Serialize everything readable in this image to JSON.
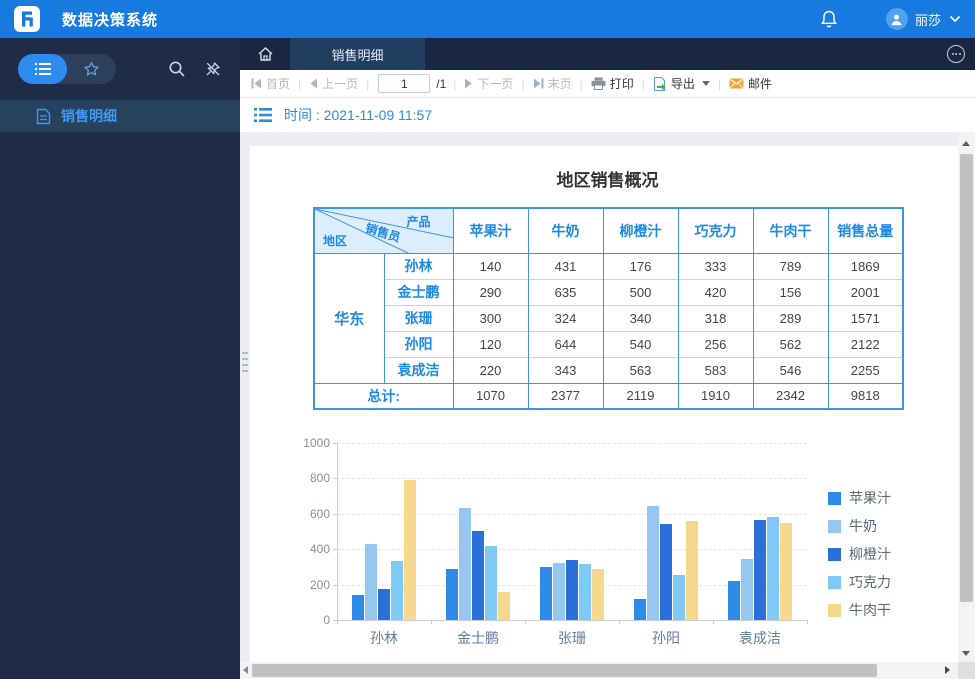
{
  "app": {
    "title": "数据决策系统",
    "user": "丽莎"
  },
  "sidebar": {
    "menu_item": "销售明细"
  },
  "tabs": {
    "active": "销售明细"
  },
  "toolbar": {
    "first": "首页",
    "prev": "上一页",
    "page_value": "1",
    "page_total": "/1",
    "next": "下一页",
    "last": "末页",
    "print": "打印",
    "export": "导出",
    "mail": "邮件"
  },
  "param_bar": {
    "time_label": "时间 : 2021-11-09 11:57"
  },
  "report": {
    "title": "地区销售概况",
    "table": {
      "corner": {
        "top": "产品",
        "middle": "销售员",
        "bottom": "地区"
      },
      "columns": [
        "苹果汁",
        "牛奶",
        "柳橙汁",
        "巧克力",
        "牛肉干",
        "销售总量"
      ],
      "region": "华东",
      "rows": [
        {
          "name": "孙林",
          "values": [
            140,
            431,
            176,
            333,
            789,
            1869
          ]
        },
        {
          "name": "金士鹏",
          "values": [
            290,
            635,
            500,
            420,
            156,
            2001
          ]
        },
        {
          "name": "张珊",
          "values": [
            300,
            324,
            340,
            318,
            289,
            1571
          ]
        },
        {
          "name": "孙阳",
          "values": [
            120,
            644,
            540,
            256,
            562,
            2122
          ]
        },
        {
          "name": "袁成洁",
          "values": [
            220,
            343,
            563,
            583,
            546,
            2255
          ]
        }
      ],
      "total_label": "总计:",
      "totals": [
        1070,
        2377,
        2119,
        1910,
        2342,
        9818
      ]
    }
  },
  "chart_data": {
    "type": "bar",
    "categories": [
      "孙林",
      "金士鹏",
      "张珊",
      "孙阳",
      "袁成洁"
    ],
    "series": [
      {
        "name": "苹果汁",
        "color": "#2F8BE8",
        "values": [
          140,
          290,
          300,
          120,
          220
        ]
      },
      {
        "name": "牛奶",
        "color": "#96C7F0",
        "values": [
          431,
          635,
          324,
          644,
          343
        ]
      },
      {
        "name": "柳橙汁",
        "color": "#2B6FD8",
        "values": [
          176,
          500,
          340,
          540,
          563
        ]
      },
      {
        "name": "巧克力",
        "color": "#7FCAF5",
        "values": [
          333,
          420,
          318,
          256,
          583
        ]
      },
      {
        "name": "牛肉干",
        "color": "#F5D78E",
        "values": [
          789,
          156,
          289,
          562,
          546
        ]
      }
    ],
    "y_ticks": [
      0,
      200,
      400,
      600,
      800,
      1000
    ],
    "ylim": [
      0,
      1000
    ],
    "grid": "dashed-horizontal",
    "legend_position": "right",
    "title": "",
    "xlabel": "",
    "ylabel": ""
  },
  "colors": {
    "header_blue": "#1879DE",
    "table_border": "#3E93E6",
    "table_text": "#1E88E5",
    "link_blue": "#2F8AE0"
  }
}
